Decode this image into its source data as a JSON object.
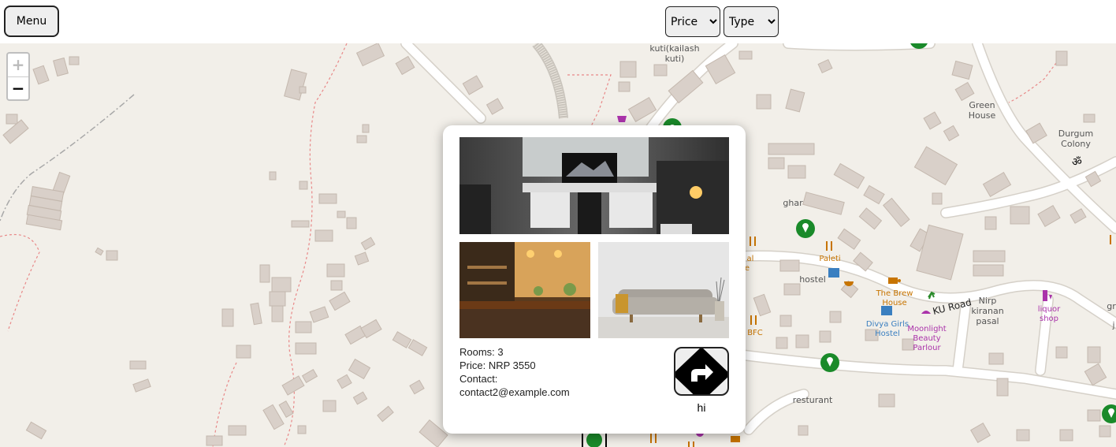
{
  "toolbar": {
    "menu_label": "Menu",
    "price_select": {
      "selected": "Price",
      "options": [
        "Price"
      ]
    },
    "type_select": {
      "selected": "Type",
      "options": [
        "Type"
      ]
    }
  },
  "zoom": {
    "in": "+",
    "out": "−"
  },
  "map": {
    "labels": {
      "kuti": "kuti(kailash",
      "kuti2": "kuti)",
      "green_house1": "Green",
      "green_house2": "House",
      "durgum1": "Durgum",
      "durgum2": "Colony",
      "ghar": "ghar",
      "paleti": "Paleti",
      "hostel": "hostel",
      "brew1": "The Brew",
      "brew2": "House",
      "ku_road": "KU Road",
      "nirp1": "Nirp",
      "nirp2": "kiranan",
      "nirp3": "pasal",
      "liquor1": "liquor",
      "liquor2": "shop",
      "divya1": "Divya Girls",
      "divya2": "Hostel",
      "moon1": "Moonlight",
      "moon2": "Beauty",
      "moon3": "Parlour",
      "bfc": "BFC",
      "resturant": "resturant",
      "al": "al",
      "e": "e",
      "gr": "gr",
      "j": "j"
    },
    "colors": {
      "background": "#f2efe9",
      "building": "#d9d0c9",
      "road": "#ffffff",
      "marker": "#1a8a2a",
      "food": "#c77400",
      "shop": "#aa33aa",
      "path": "#e88888"
    }
  },
  "popup": {
    "images": [
      {
        "name": "desk-room-photo"
      },
      {
        "name": "kitchen-photo"
      },
      {
        "name": "sofa-photo"
      }
    ],
    "rooms": "Rooms: 3",
    "price": "Price: NRP 3550",
    "contact_label": "Contact:",
    "contact": "contact2@example.com",
    "directions_label": "hi"
  }
}
